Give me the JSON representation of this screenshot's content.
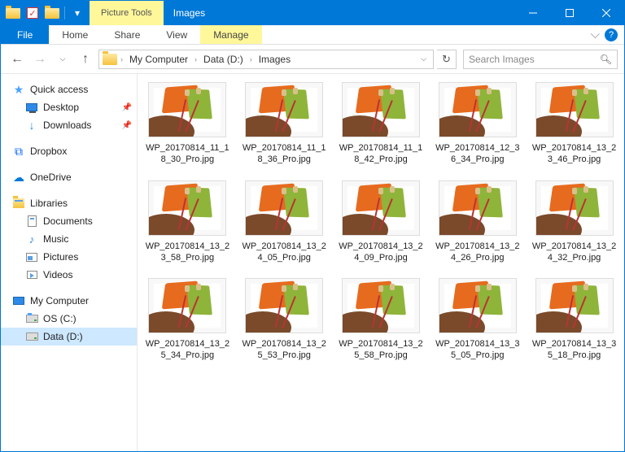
{
  "titlebar": {
    "context_tab": "Picture Tools",
    "title": "Images"
  },
  "ribbon": {
    "file": "File",
    "home": "Home",
    "share": "Share",
    "view": "View",
    "manage": "Manage"
  },
  "breadcrumb": {
    "root": "My Computer",
    "drive": "Data (D:)",
    "folder": "Images"
  },
  "search": {
    "placeholder": "Search Images"
  },
  "nav": {
    "quick_access": "Quick access",
    "desktop": "Desktop",
    "downloads": "Downloads",
    "dropbox": "Dropbox",
    "onedrive": "OneDrive",
    "libraries": "Libraries",
    "documents": "Documents",
    "music": "Music",
    "pictures": "Pictures",
    "videos": "Videos",
    "my_computer": "My Computer",
    "os_c": "OS (C:)",
    "data_d": "Data (D:)"
  },
  "files": [
    "WP_20170814_11_18_30_Pro.jpg",
    "WP_20170814_11_18_36_Pro.jpg",
    "WP_20170814_11_18_42_Pro.jpg",
    "WP_20170814_12_36_34_Pro.jpg",
    "WP_20170814_13_23_46_Pro.jpg",
    "WP_20170814_13_23_58_Pro.jpg",
    "WP_20170814_13_24_05_Pro.jpg",
    "WP_20170814_13_24_09_Pro.jpg",
    "WP_20170814_13_24_26_Pro.jpg",
    "WP_20170814_13_24_32_Pro.jpg",
    "WP_20170814_13_25_34_Pro.jpg",
    "WP_20170814_13_25_53_Pro.jpg",
    "WP_20170814_13_25_58_Pro.jpg",
    "WP_20170814_13_35_05_Pro.jpg",
    "WP_20170814_13_35_18_Pro.jpg"
  ]
}
